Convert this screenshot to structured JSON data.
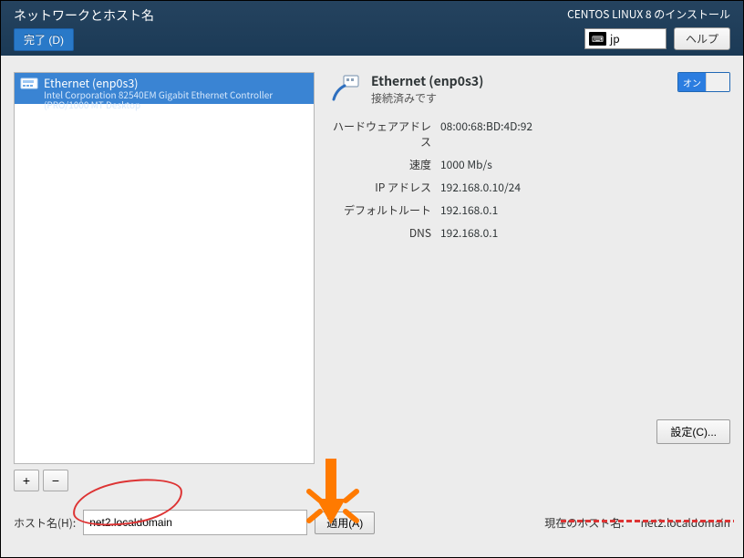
{
  "header": {
    "title": "ネットワークとホスト名",
    "done_label": "完了 (D)",
    "install_title": "CENTOS LINUX 8 のインストール",
    "keyboard_layout": "jp",
    "help_label": "ヘルプ"
  },
  "interface_list": {
    "items": [
      {
        "name": "Ethernet (enp0s3)",
        "description": "Intel Corporation 82540EM Gigabit Ethernet Controller (PRO/1000 MT Desktop"
      }
    ],
    "add_label": "+",
    "remove_label": "−"
  },
  "details": {
    "title": "Ethernet (enp0s3)",
    "status": "接続済みです",
    "switch_on_label": "オン",
    "rows": [
      {
        "k": "ハードウェアアドレス",
        "v": "08:00:68:BD:4D:92"
      },
      {
        "k": "速度",
        "v": "1000 Mb/s"
      },
      {
        "k": "IP アドレス",
        "v": "192.168.0.10/24"
      },
      {
        "k": "デフォルトルート",
        "v": "192.168.0.1"
      },
      {
        "k": "DNS",
        "v": "192.168.0.1"
      }
    ],
    "configure_label": "設定(C)..."
  },
  "hostname": {
    "label": "ホスト名(H):",
    "value": "net2.localdomain",
    "apply_label": "適用(A)",
    "current_label": "現在のホスト名:",
    "current_value": "net2.localdomain"
  }
}
